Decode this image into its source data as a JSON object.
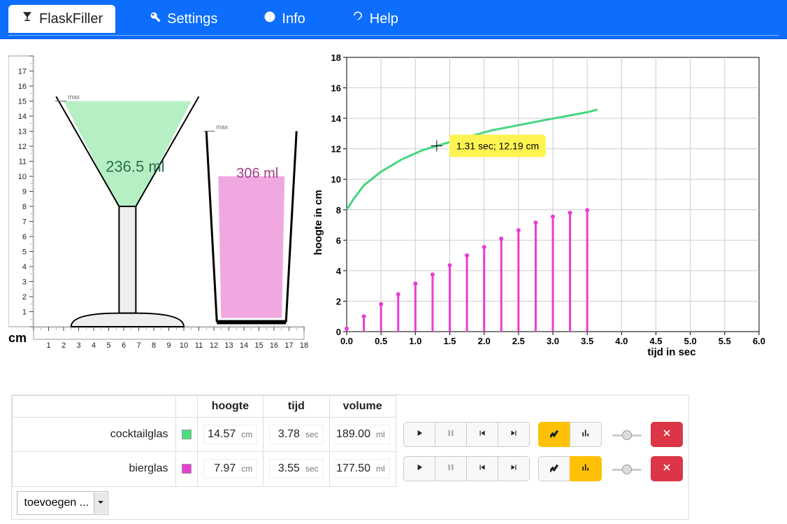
{
  "nav": {
    "flaskfiller": "FlaskFiller",
    "settings": "Settings",
    "info": "Info",
    "help": "Help"
  },
  "sim": {
    "cm_label": "cm",
    "ruler_y": [
      1,
      2,
      3,
      4,
      5,
      6,
      7,
      8,
      9,
      10,
      11,
      12,
      13,
      14,
      15,
      16,
      17
    ],
    "ruler_x": [
      1,
      2,
      3,
      4,
      5,
      6,
      7,
      8,
      9,
      10,
      11,
      12,
      13,
      14,
      15,
      16,
      17,
      18
    ],
    "max_label": "max",
    "cocktail_volume": "236.5 ml",
    "beer_volume": "306 ml"
  },
  "chart_data": {
    "type": "mixed",
    "xlabel": "tijd in sec",
    "ylabel": "hoogte in cm",
    "xlim": [
      0,
      6.0
    ],
    "ylim": [
      0,
      18
    ],
    "xticks": [
      0.0,
      0.5,
      1.0,
      1.5,
      2.0,
      2.5,
      3.0,
      3.5,
      4.0,
      4.5,
      5.0,
      5.5,
      6.0
    ],
    "yticks": [
      0,
      2,
      4,
      6,
      8,
      10,
      12,
      14,
      16,
      18
    ],
    "tooltip": "1.31 sec; 12.19 cm",
    "cursor": {
      "x": 1.31,
      "y": 12.19
    },
    "series": [
      {
        "name": "cocktailglas",
        "render": "curve",
        "color": "#45d67f",
        "x": [
          0.0,
          0.1,
          0.25,
          0.5,
          0.8,
          1.1,
          1.31,
          1.7,
          2.1,
          2.5,
          2.9,
          3.2,
          3.5,
          3.65
        ],
        "y": [
          8.0,
          8.7,
          9.6,
          10.5,
          11.3,
          11.9,
          12.19,
          12.7,
          13.2,
          13.55,
          13.9,
          14.15,
          14.4,
          14.57
        ]
      },
      {
        "name": "bierglas",
        "render": "bars",
        "color": "#e83ed2",
        "x": [
          0.0,
          0.25,
          0.5,
          0.75,
          1.0,
          1.25,
          1.5,
          1.75,
          2.0,
          2.25,
          2.5,
          2.75,
          3.0,
          3.25,
          3.5
        ],
        "y": [
          0.2,
          1.0,
          1.8,
          2.45,
          3.15,
          3.75,
          4.35,
          5.0,
          5.55,
          6.1,
          6.65,
          7.15,
          7.55,
          7.8,
          7.97
        ]
      }
    ]
  },
  "table": {
    "headers": {
      "hoogte": "hoogte",
      "tijd": "tijd",
      "volume": "volume"
    },
    "units": {
      "cm": "cm",
      "sec": "sec",
      "ml": "ml"
    },
    "rows": [
      {
        "name": "cocktailglas",
        "hoogte": "14.57",
        "tijd": "3.78",
        "volume": "189.00",
        "line_active": true,
        "bar_active": false,
        "color": "green"
      },
      {
        "name": "bierglas",
        "hoogte": "7.97",
        "tijd": "3.55",
        "volume": "177.50",
        "line_active": false,
        "bar_active": true,
        "color": "pink"
      }
    ],
    "add_label": "toevoegen ..."
  }
}
